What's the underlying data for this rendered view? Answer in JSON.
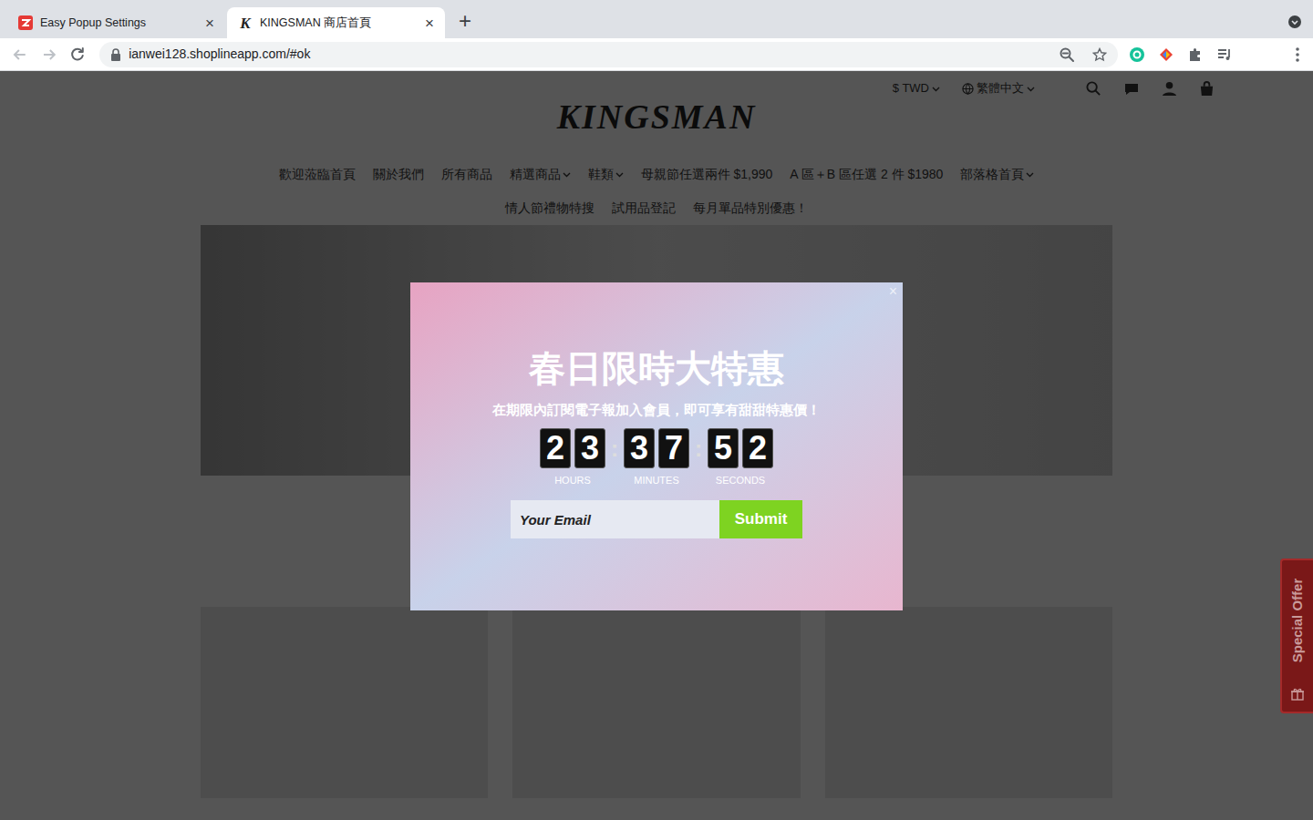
{
  "browser": {
    "tabs": [
      {
        "label": "Easy Popup Settings",
        "selected": false,
        "close": "×"
      },
      {
        "label": "KINGSMAN 商店首頁",
        "selected": true,
        "close": "×",
        "favicon": "K"
      }
    ],
    "new_tab": "+",
    "url": "ianwei128.shoplineapp.com/#ok"
  },
  "store": {
    "currency": "$ TWD",
    "language": "繁體中文",
    "logo": "KINGSMAN",
    "nav_rows": [
      [
        {
          "label": "歡迎蒞臨首頁",
          "dropdown": false
        },
        {
          "label": "關於我們",
          "dropdown": false
        },
        {
          "label": "所有商品",
          "dropdown": false
        },
        {
          "label": "精選商品",
          "dropdown": true
        },
        {
          "label": "鞋類",
          "dropdown": true
        },
        {
          "label": "母親節任選兩件 $1,990",
          "dropdown": false
        },
        {
          "label": "A 區＋B 區任選 2 件 $1980",
          "dropdown": false
        },
        {
          "label": "部落格首頁",
          "dropdown": true
        }
      ],
      [
        {
          "label": "情人節禮物特搜",
          "dropdown": false
        },
        {
          "label": "試用品登記",
          "dropdown": false
        },
        {
          "label": "每月單品特別優惠！",
          "dropdown": false
        }
      ]
    ]
  },
  "side_tab": "Special Offer",
  "popup": {
    "close": "×",
    "title": "春日限時大特惠",
    "subtitle": "在期限內訂閱電子報加入會員，即可享有甜甜特惠價！",
    "separator": ":",
    "countdown": [
      {
        "digits": [
          "2",
          "3"
        ],
        "label": "HOURS"
      },
      {
        "digits": [
          "3",
          "7"
        ],
        "label": "MINUTES"
      },
      {
        "digits": [
          "5",
          "2"
        ],
        "label": "SECONDS"
      }
    ],
    "email_placeholder": "Your Email",
    "submit": "Submit"
  }
}
